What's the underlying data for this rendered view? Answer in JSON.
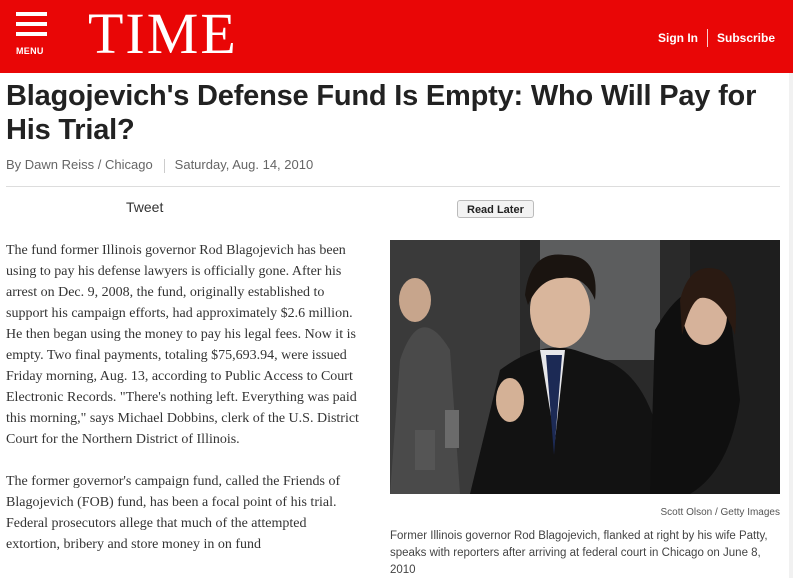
{
  "header": {
    "menu_label": "MENU",
    "logo": "TIME",
    "sign_in": "Sign In",
    "subscribe": "Subscribe",
    "brand_color": "#e90606"
  },
  "article": {
    "headline": "Blagojevich's Defense Fund Is Empty: Who Will Pay for His Trial?",
    "byline": "By Dawn Reiss / Chicago",
    "date": "Saturday, Aug. 14, 2010",
    "tweet_label": "Tweet",
    "read_later_label": "Read Later",
    "paragraphs": [
      "The fund former Illinois governor Rod Blagojevich has been using to pay his defense lawyers is officially gone. After his arrest on Dec. 9, 2008, the fund, originally established to support his campaign efforts, had approximately $2.6 million. He then began using the money to pay his legal fees. Now it is empty. Two final payments, totaling $75,693.94, were issued Friday morning, Aug. 13, according to Public Access to Court Electronic Records. \"There's nothing left. Everything was paid this morning,\" says Michael Dobbins, clerk of the U.S. District Court for the Northern District of Illinois.",
      "The former governor's campaign fund, called the Friends of Blagojevich (FOB) fund, has been a focal point of his trial. Federal prosecutors allege that much of the attempted extortion, bribery and store money in on fund"
    ]
  },
  "photo": {
    "credit": "Scott Olson / Getty Images",
    "caption": "Former Illinois governor Rod Blagojevich, flanked at right by his wife Patty, speaks with reporters after arriving at federal court in Chicago on June 8, 2010"
  }
}
